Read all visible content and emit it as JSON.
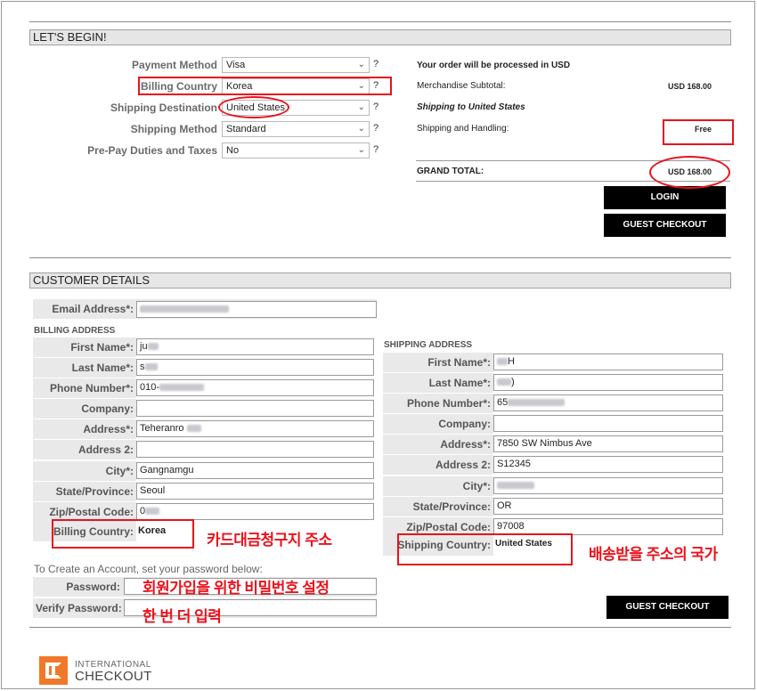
{
  "lets_begin": {
    "title": "LET'S BEGIN!",
    "fields": [
      {
        "label": "Payment Method",
        "value": "Visa",
        "help": "?"
      },
      {
        "label": "Billing Country",
        "value": "Korea",
        "help": "?"
      },
      {
        "label": "Shipping Destination",
        "value": "United States",
        "help": "?"
      },
      {
        "label": "Shipping Method",
        "value": "Standard",
        "help": "?"
      },
      {
        "label": "Pre-Pay Duties and Taxes",
        "value": "No",
        "help": "?"
      }
    ]
  },
  "summary": {
    "currency_note": "Your order will be processed in USD",
    "subtotal_label": "Merchandise Subtotal:",
    "subtotal_value": "USD 168.00",
    "shipping_to": "Shipping to United States",
    "handling_label": "Shipping and Handling:",
    "handling_value": "Free",
    "grand_total_label": "GRAND TOTAL:",
    "grand_total_value": "USD 168.00",
    "login_label": "LOGIN",
    "guest_checkout_label": "GUEST CHECKOUT"
  },
  "customer_details": {
    "title": "CUSTOMER DETAILS",
    "email_label": "Email Address*:",
    "billing": {
      "heading": "BILLING ADDRESS",
      "fields": [
        {
          "label": "First Name*:",
          "value": "ju"
        },
        {
          "label": "Last Name*:",
          "value": "s"
        },
        {
          "label": "Phone Number*:",
          "value": "010-"
        },
        {
          "label": "Company:",
          "value": ""
        },
        {
          "label": "Address*:",
          "value": "Teheranro"
        },
        {
          "label": "Address 2:",
          "value": ""
        },
        {
          "label": "City*:",
          "value": "Gangnamgu"
        },
        {
          "label": "State/Province:",
          "value": "Seoul"
        },
        {
          "label": "Zip/Postal Code:",
          "value": "0"
        }
      ],
      "country_label": "Billing Country:",
      "country_value": "Korea"
    },
    "shipping": {
      "heading": "SHIPPING ADDRESS",
      "fields": [
        {
          "label": "First Name*:",
          "value": "H"
        },
        {
          "label": "Last Name*:",
          "value": ")"
        },
        {
          "label": "Phone Number*:",
          "value": "65"
        },
        {
          "label": "Company:",
          "value": ""
        },
        {
          "label": "Address*:",
          "value": "7850 SW Nimbus Ave"
        },
        {
          "label": "Address 2:",
          "value": "S12345"
        },
        {
          "label": "City*:",
          "value": ""
        },
        {
          "label": "State/Province:",
          "value": "OR"
        },
        {
          "label": "Zip/Postal Code:",
          "value": "97008"
        }
      ],
      "country_label": "Shipping Country:",
      "country_value": "United States"
    },
    "account_note": "To Create an Account, set your password below:",
    "password_label": "Password:",
    "verify_password_label": "Verify Password:",
    "guest_checkout_label": "GUEST CHECKOUT"
  },
  "annotations": {
    "billing_note": "카드대금청구지 주소",
    "shipping_note": "배송받을 주소의 국가",
    "password_note": "회원가입을 위한 비밀번호 설정",
    "verify_note": "한 번 더 입력"
  },
  "logo": {
    "line1": "INTERNATIONAL",
    "line2": "CHECKOUT",
    "icon": "ic-logo-icon",
    "color": "#f0782a"
  },
  "colors": {
    "annotation_red": "#e8131d",
    "button_black": "#000000"
  }
}
